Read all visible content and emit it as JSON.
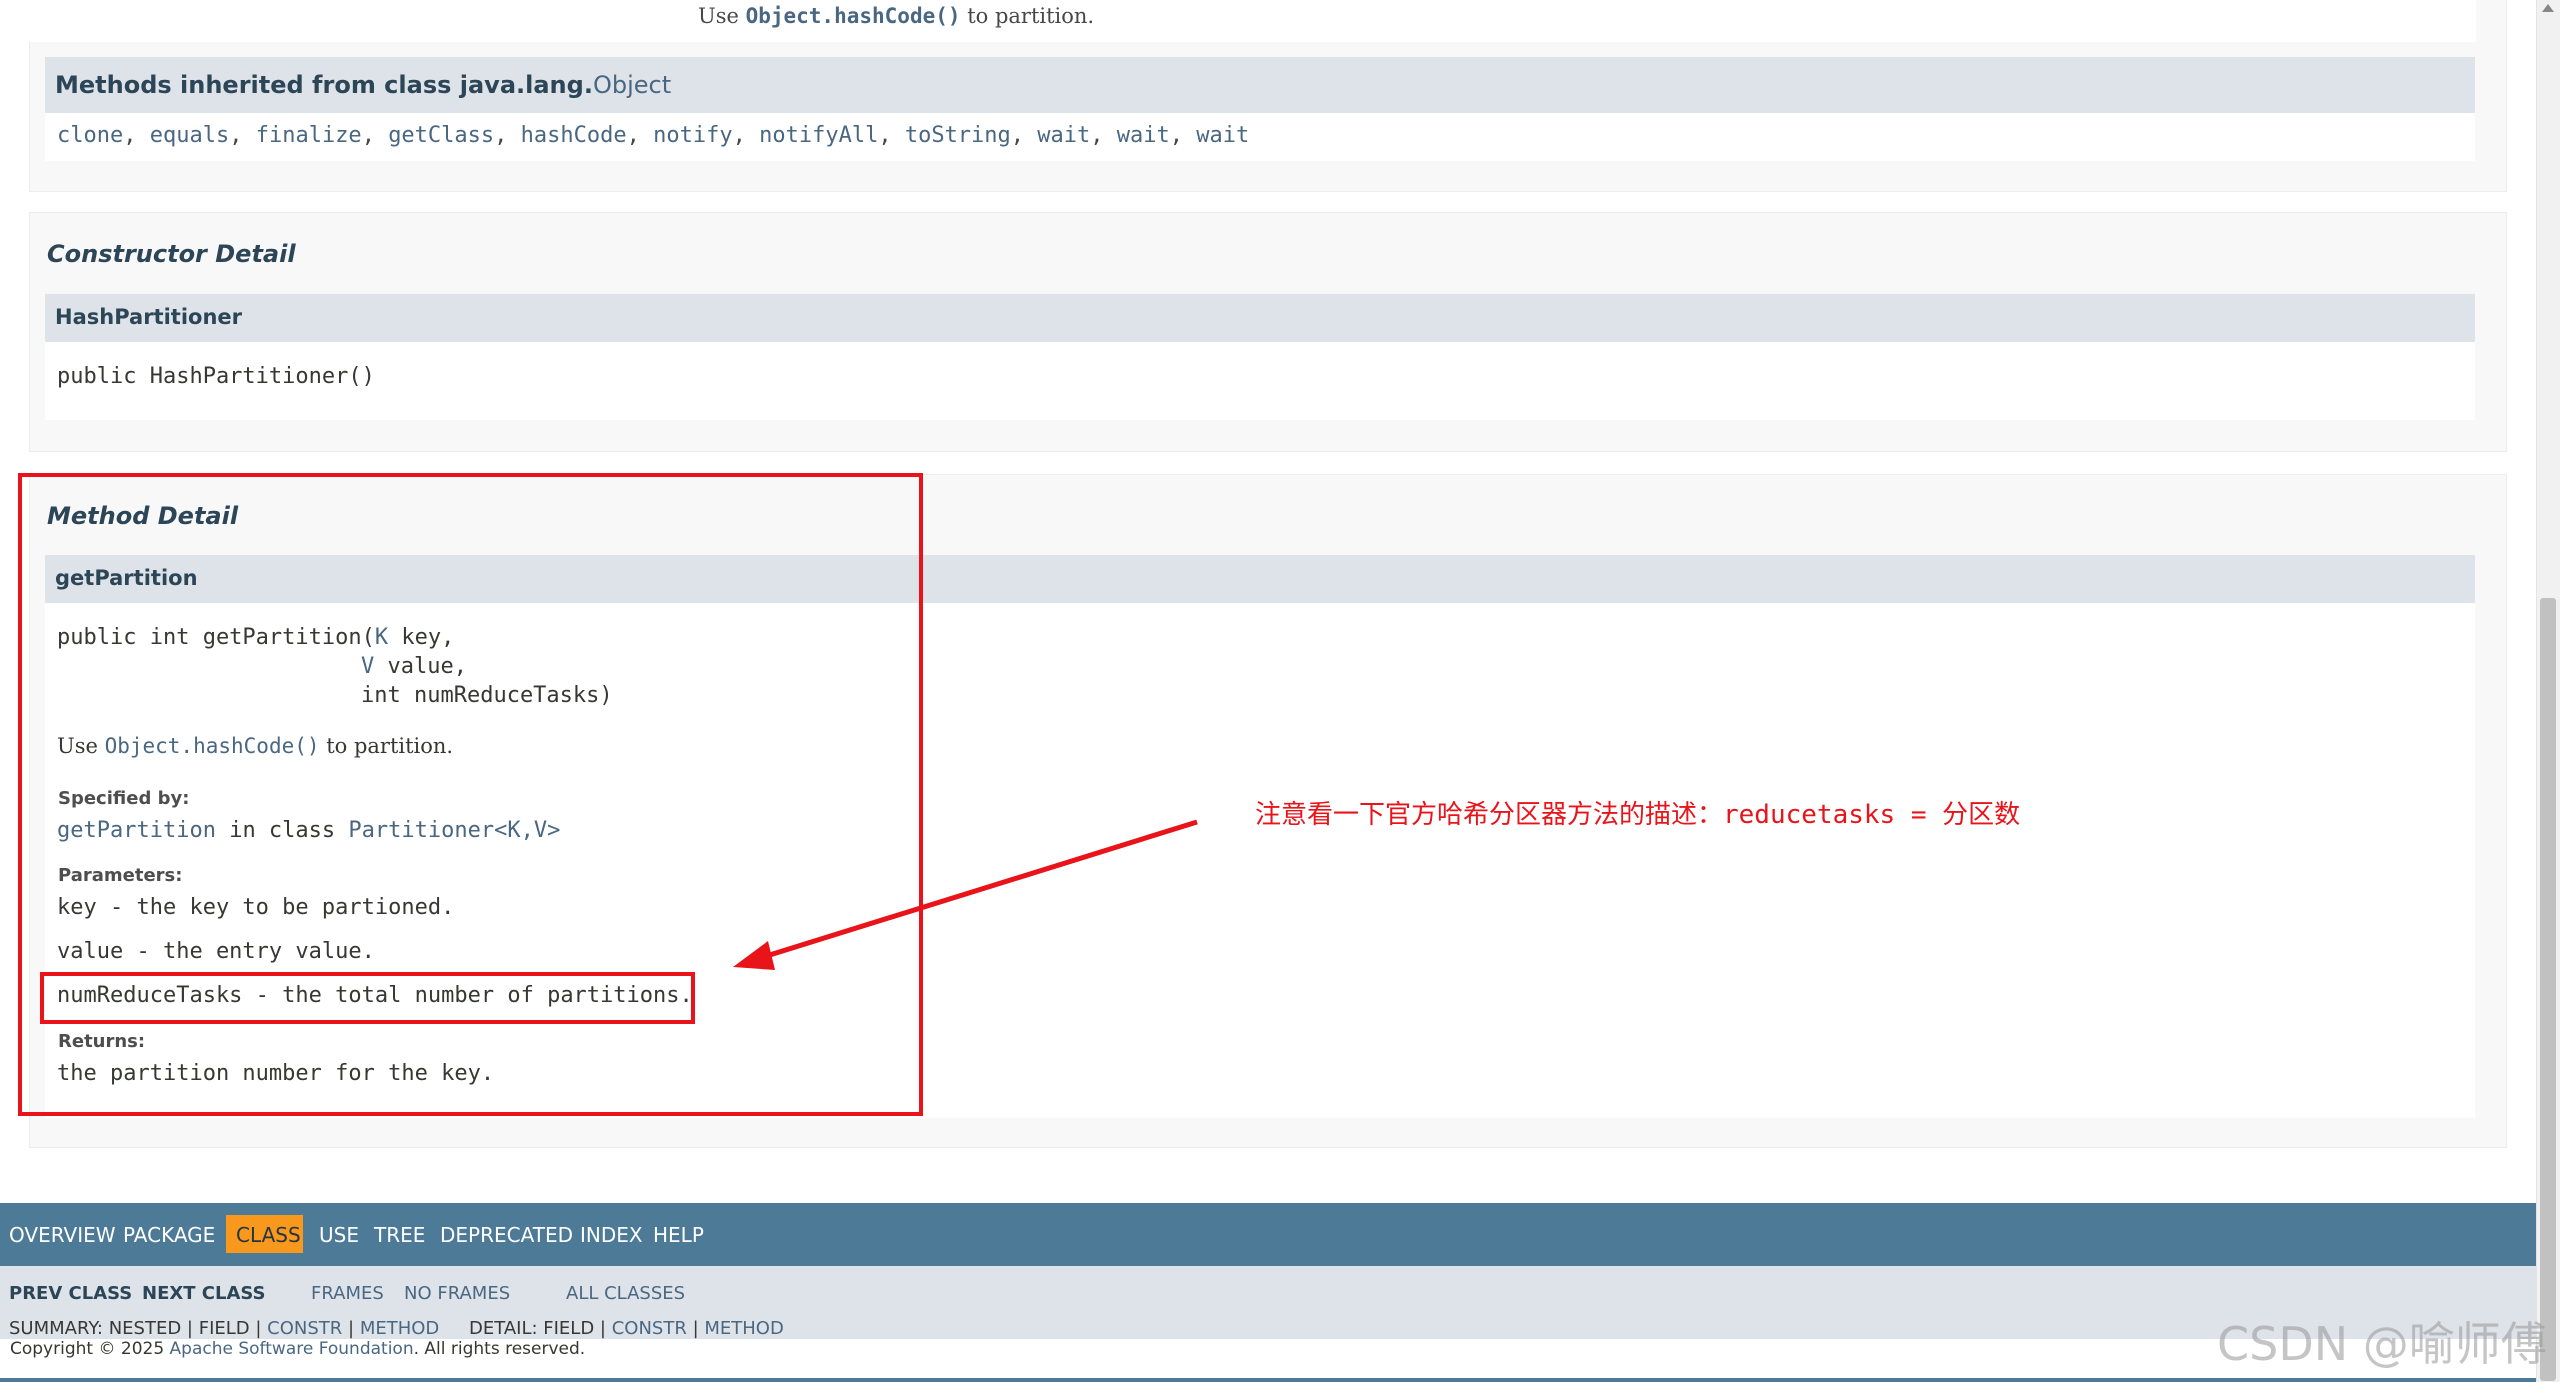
{
  "top_line": {
    "prefix": "Use ",
    "code": "Object.hashCode()",
    "suffix": " to partition."
  },
  "inherited": {
    "title_prefix": "Methods inherited from class java.lang.",
    "title_link": "Object",
    "methods": [
      "clone",
      "equals",
      "finalize",
      "getClass",
      "hashCode",
      "notify",
      "notifyAll",
      "toString",
      "wait",
      "wait",
      "wait"
    ]
  },
  "constructor_detail": {
    "title": "Constructor Detail",
    "member_name": "HashPartitioner",
    "signature": "public HashPartitioner()"
  },
  "method_detail": {
    "title": "Method Detail",
    "member_name": "getPartition",
    "sig_line1_prefix": "public int getPartition(",
    "sig_line1_type": "K",
    "sig_line1_suffix": " key,",
    "sig_line2_type": "V",
    "sig_line2_suffix": " value,",
    "sig_line3": "int numReduceTasks)",
    "desc_prefix": "Use ",
    "desc_code": "Object.hashCode()",
    "desc_suffix": " to partition.",
    "specified_by_label": "Specified by:",
    "specified_by_method": "getPartition",
    "specified_by_middle": " in class ",
    "specified_by_class": "Partitioner<K,V>",
    "parameters_label": "Parameters:",
    "param_key": "key - the key to be partioned.",
    "param_value": "value - the entry value.",
    "param_num": "numReduceTasks - the total number of partitions.",
    "returns_label": "Returns:",
    "returns_text": "the partition number for the key."
  },
  "annotation": {
    "text": "注意看一下官方哈希分区器方法的描述：reducetasks = 分区数",
    "color": "#e8141a"
  },
  "nav": {
    "items": [
      "OVERVIEW",
      "PACKAGE",
      "CLASS",
      "USE",
      "TREE",
      "DEPRECATED",
      "INDEX",
      "HELP"
    ],
    "active": "CLASS",
    "prev_class": "PREV CLASS",
    "next_class": "NEXT CLASS",
    "frames": "FRAMES",
    "no_frames": "NO FRAMES",
    "all_classes": "ALL CLASSES",
    "summary_prefix": "SUMMARY: NESTED | FIELD | ",
    "summary_constr": "CONSTR",
    "summary_sep": " | ",
    "summary_method": "METHOD",
    "detail_prefix": "DETAIL: FIELD | ",
    "detail_constr": "CONSTR",
    "detail_sep": " | ",
    "detail_method": "METHOD"
  },
  "legal": {
    "prefix": "Copyright © 2025 ",
    "link": "Apache Software Foundation",
    "suffix": ". All rights reserved."
  },
  "watermark": "CSDN @喻师傅",
  "colors": {
    "nav_bar": "#4D7A97",
    "nav_active": "#F8981D",
    "header_bg": "#dee3e9",
    "link": "#4A6782",
    "annotation_red": "#e8141a"
  }
}
